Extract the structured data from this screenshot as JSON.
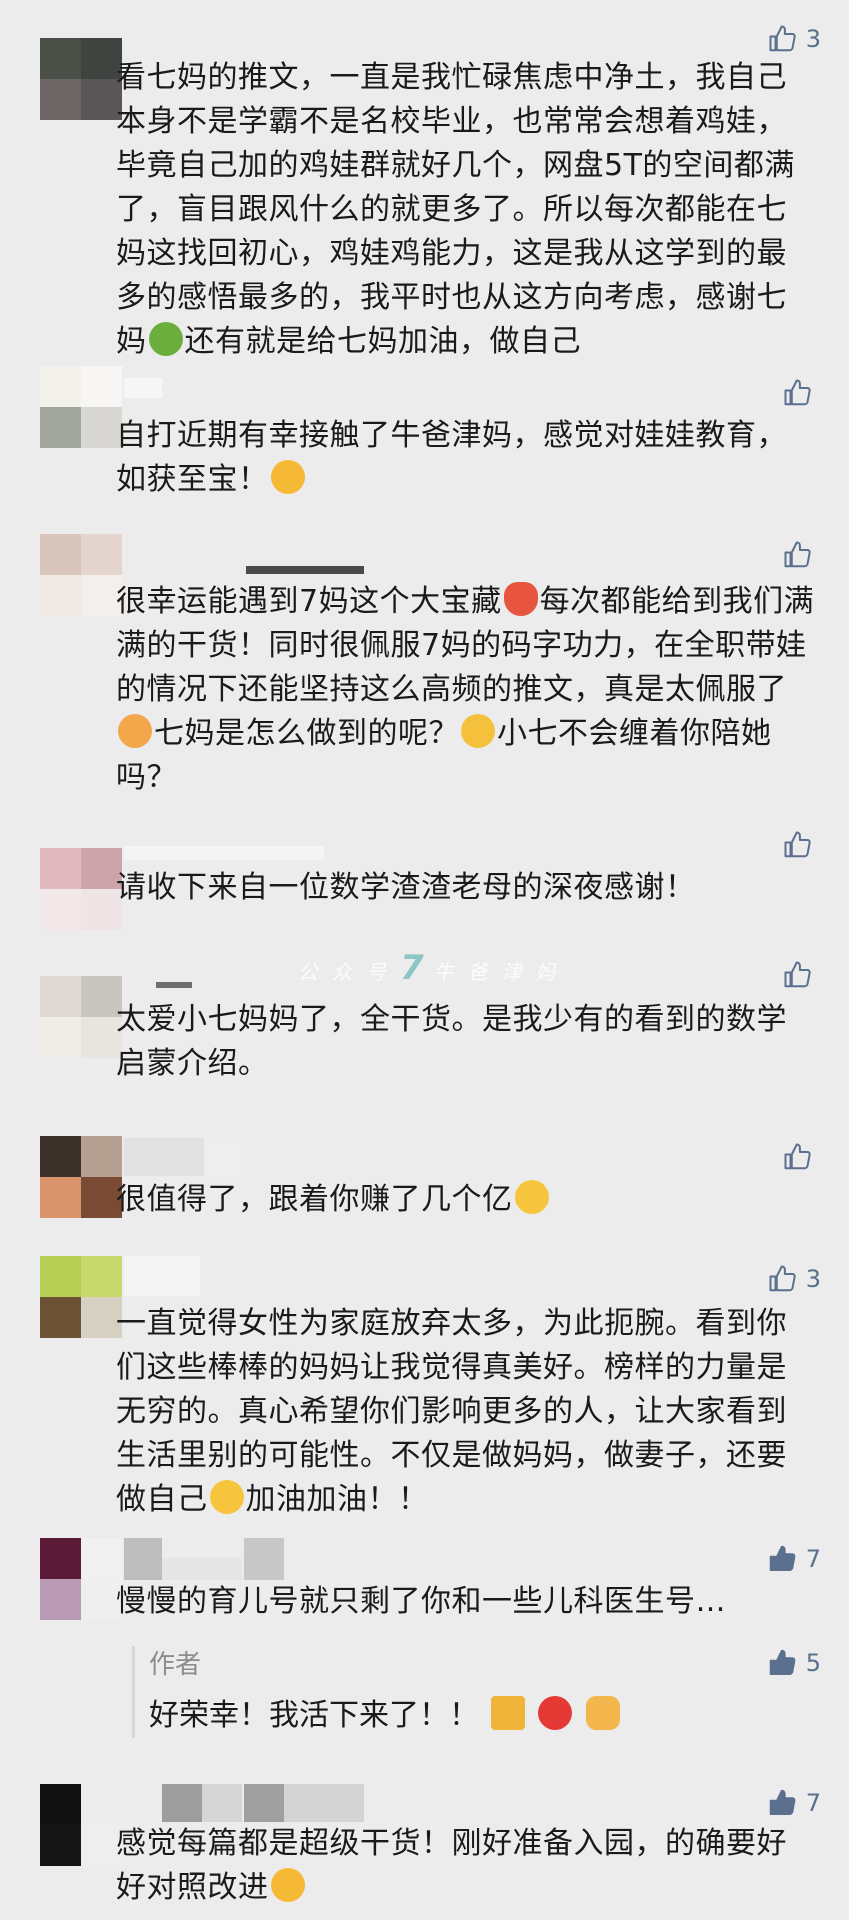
{
  "colors": {
    "background": "#ececec",
    "like_blue": "#5b6f8f",
    "text": "#1a1a1a",
    "muted": "#8c8c8c"
  },
  "watermark": {
    "prefix": "公众号",
    "seven": "7",
    "suffix": "牛爸津妈"
  },
  "comments": [
    {
      "likes": "3",
      "text_parts": [
        "看七妈的推文，一直是我忙碌焦虑中净土，我自己本身不是学霸不是名校毕业，也常常会想着鸡娃，毕竟自己加的鸡娃群就好几个，网盘5T的空间都满了，盲目跟风什么的就更多了。所以每次都能在七妈这找回初心，鸡娃鸡能力，这是我从这学到的最多的感悟最多的，我平时也从这方向考虑，感谢七妈",
        "还有就是给七妈加油，做自己"
      ],
      "emoji": "green-person-emoji"
    },
    {
      "likes": "",
      "text_parts": [
        "自打近期有幸接触了牛爸津妈，感觉对娃娃教育，如获至宝！",
        ""
      ],
      "emoji": "shushing-face-emoji"
    },
    {
      "likes": "",
      "text_parts": [
        "很幸运能遇到7妈这个大宝藏",
        "每次都能给到我们满满的干货！同时很佩服7妈的码字功力，在全职带娃的情况下还能坚持这么高频的推文，真是太佩服了",
        "七妈是怎么做到的呢？",
        "小七不会缠着你陪她吗？"
      ],
      "emoji": "heart-emoji"
    },
    {
      "likes": "",
      "text_parts": [
        "请收下来自一位数学渣渣老母的深夜感谢！"
      ]
    },
    {
      "likes": "",
      "text_parts": [
        "太爱小七妈妈了，全干货。是我少有的看到的数学启蒙介绍。"
      ]
    },
    {
      "likes": "",
      "text_parts": [
        "很值得了，跟着你赚了几个亿",
        ""
      ],
      "emoji": "smile-emoji"
    },
    {
      "likes": "3",
      "text_parts": [
        "一直觉得女性为家庭放弃太多，为此扼腕。看到你们这些棒棒的妈妈让我觉得真美好。榜样的力量是无穷的。真心希望你们影响更多的人，让大家看到生活里别的可能性。不仅是做妈妈，做妻子，还要做自己",
        "加油加油！！"
      ],
      "emoji": "smile-emoji"
    },
    {
      "likes": "7",
      "text_parts": [
        "慢慢的育儿号就只剩了你和一些儿科医生号…"
      ],
      "reply": {
        "author": "作者",
        "likes": "5",
        "text": "好荣幸！我活下来了！！"
      }
    },
    {
      "likes": "7",
      "text_parts": [
        "感觉每篇都是超级干货！刚好准备入园，的确要好好对照改进",
        ""
      ],
      "emoji": "shushing-face-emoji"
    }
  ]
}
